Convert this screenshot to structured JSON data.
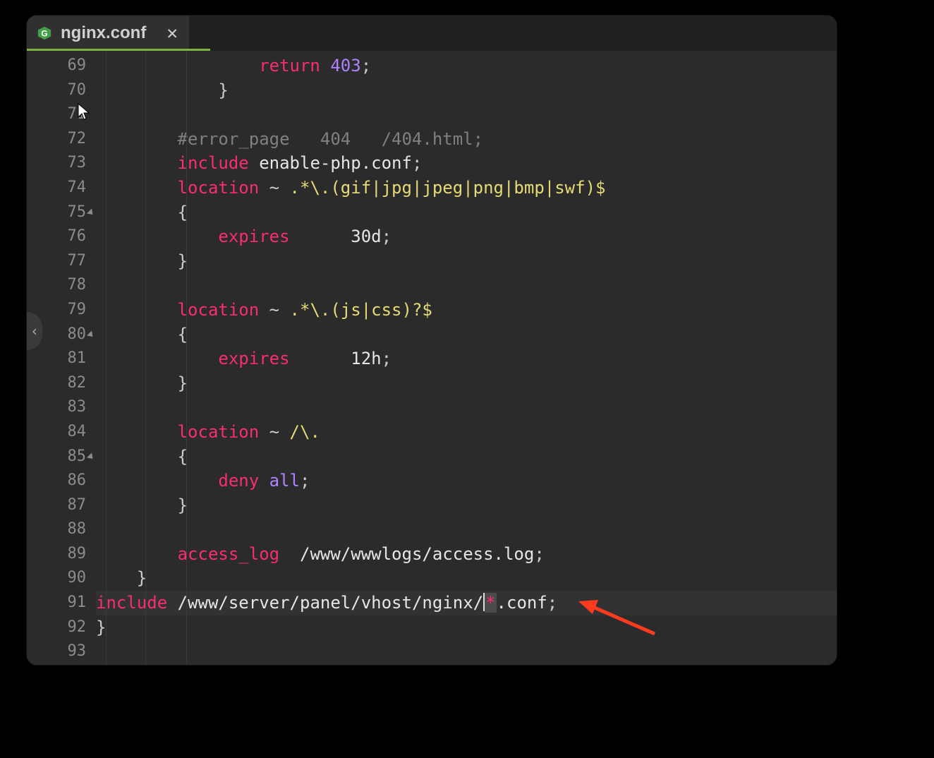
{
  "tab": {
    "filename": "nginx.conf",
    "close_glyph": "✕"
  },
  "gutter": {
    "start": 69,
    "end": 93,
    "fold_lines": [
      75,
      80,
      85
    ]
  },
  "tokens": {
    "return": "return",
    "include": "include",
    "location": "location",
    "expires": "expires",
    "deny": "deny",
    "all": "all",
    "access_log": "access_log"
  },
  "code": {
    "l69_num": "403",
    "l72_comment": "#error_page   404   /404.html;",
    "l73_file": "enable-php.conf",
    "l74_regex": ".*\\.(",
    "l74_exts": "gif|jpg|jpeg|png|bmp|swf",
    "l74_close": ")$",
    "l76_val": "30d",
    "l79_regex": ".*\\.(",
    "l79_exts": "js|css",
    "l79_close": ")?$",
    "l81_val": "12h",
    "l84_regex": "/\\.",
    "l89_path": "/www/wwwlogs/access.log",
    "l91_path": "/www/server/panel/vhost/nginx/",
    "l91_glob": "*",
    "l91_ext": ".conf"
  },
  "side_arrow_glyph": "‹"
}
